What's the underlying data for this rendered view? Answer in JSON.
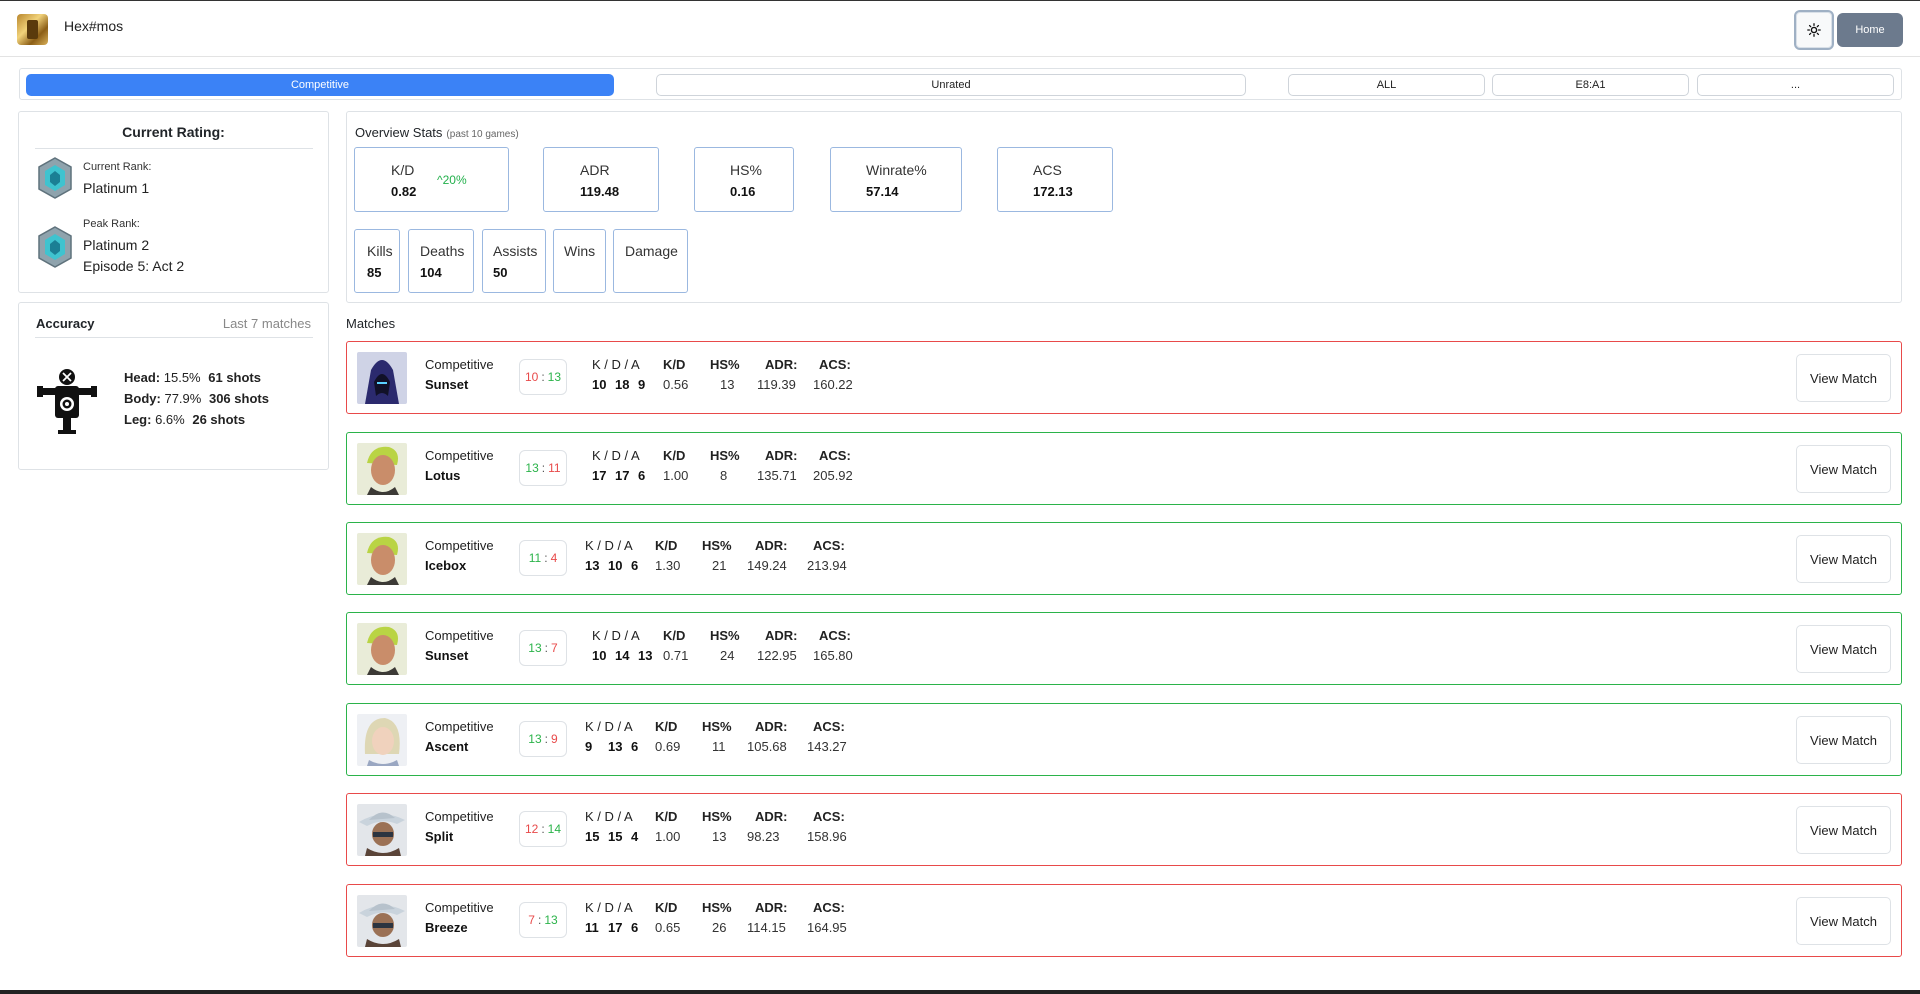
{
  "header": {
    "username": "Hex#mos",
    "home_label": "Home"
  },
  "filters": [
    {
      "label": "Competitive",
      "active": true
    },
    {
      "label": "Unrated",
      "active": false
    },
    {
      "label": "ALL",
      "active": false
    },
    {
      "label": "E8:A1",
      "active": false
    },
    {
      "label": "...",
      "active": false
    }
  ],
  "rating": {
    "title": "Current Rating:",
    "current_label": "Current Rank:",
    "current_value": "Platinum 1",
    "peak_label": "Peak Rank:",
    "peak_value": "Platinum 2",
    "peak_episode": "Episode 5: Act 2"
  },
  "accuracy": {
    "title": "Accuracy",
    "subtitle": "Last 7 matches",
    "head_label": "Head:",
    "head_pct": "15.5%",
    "head_shots": "61 shots",
    "body_label": "Body:",
    "body_pct": "77.9%",
    "body_shots": "306 shots",
    "leg_label": "Leg:",
    "leg_pct": "6.6%",
    "leg_shots": "26 shots"
  },
  "overview": {
    "title": "Overview Stats",
    "subtitle": "(past 10 games)",
    "kd_label": "K/D",
    "kd_value": "0.82",
    "kd_delta": "^20%",
    "adr_label": "ADR",
    "adr_value": "119.48",
    "hs_label": "HS%",
    "hs_value": "0.16",
    "winrate_label": "Winrate%",
    "winrate_value": "57.14",
    "acs_label": "ACS",
    "acs_value": "172.13",
    "kills_label": "Kills",
    "kills_value": "85",
    "deaths_label": "Deaths",
    "deaths_value": "104",
    "assists_label": "Assists",
    "assists_value": "50",
    "wins_label": "Wins",
    "damage_label": "Damage"
  },
  "matches_title": "Matches",
  "labels": {
    "kda": "K / D / A",
    "kd": "K/D",
    "hs": "HS%",
    "adr": "ADR:",
    "acs": "ACS:",
    "view": "View Match",
    "colon": ":"
  },
  "matches": [
    {
      "mode": "Competitive",
      "map": "Sunset",
      "result": "loss",
      "score_a": "10",
      "score_b": "13",
      "k": "10",
      "d": "18",
      "a": "9",
      "kd": "0.56",
      "hs": "13",
      "adr": "119.39",
      "acs": "160.22",
      "agent": "omen"
    },
    {
      "mode": "Competitive",
      "map": "Lotus",
      "result": "win",
      "score_a": "13",
      "score_b": "11",
      "k": "17",
      "d": "17",
      "a": "6",
      "kd": "1.00",
      "hs": "8",
      "adr": "135.71",
      "acs": "205.92",
      "agent": "blonde"
    },
    {
      "mode": "Competitive",
      "map": "Icebox",
      "result": "win",
      "score_a": "11",
      "score_b": "4",
      "k": "13",
      "d": "10",
      "a": "6",
      "kd": "1.30",
      "hs": "21",
      "adr": "149.24",
      "acs": "213.94",
      "agent": "blonde"
    },
    {
      "mode": "Competitive",
      "map": "Sunset",
      "result": "win",
      "score_a": "13",
      "score_b": "7",
      "k": "10",
      "d": "14",
      "a": "13",
      "kd": "0.71",
      "hs": "24",
      "adr": "122.95",
      "acs": "165.80",
      "agent": "blonde"
    },
    {
      "mode": "Competitive",
      "map": "Ascent",
      "result": "win",
      "score_a": "13",
      "score_b": "9",
      "k": "9",
      "d": "13",
      "a": "6",
      "kd": "0.69",
      "hs": "11",
      "adr": "105.68",
      "acs": "143.27",
      "agent": "fair"
    },
    {
      "mode": "Competitive",
      "map": "Split",
      "result": "loss",
      "score_a": "12",
      "score_b": "14",
      "k": "15",
      "d": "15",
      "a": "4",
      "kd": "1.00",
      "hs": "13",
      "adr": "98.23",
      "acs": "158.96",
      "agent": "hat"
    },
    {
      "mode": "Competitive",
      "map": "Breeze",
      "result": "loss",
      "score_a": "7",
      "score_b": "13",
      "k": "11",
      "d": "17",
      "a": "6",
      "kd": "0.65",
      "hs": "26",
      "adr": "114.15",
      "acs": "164.95",
      "agent": "hat"
    }
  ],
  "colors": {
    "accent": "#3b82f6",
    "win": "#2bb34a",
    "loss": "#e84a4a",
    "stat_border": "#9bb8e0"
  }
}
